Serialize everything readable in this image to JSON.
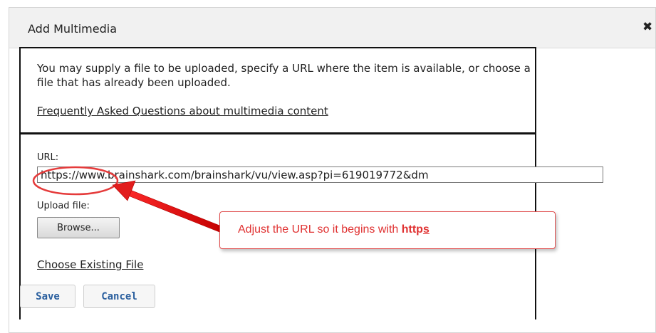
{
  "dialog": {
    "title": "Add Multimedia",
    "close_icon": "close-icon"
  },
  "intro": {
    "text": "You may supply a file to be uploaded, specify a URL where the item is available, or choose a file that has already been uploaded.",
    "faq_link": "Frequently Asked Questions about multimedia content"
  },
  "form": {
    "url_label": "URL:",
    "url_value": "https://www.brainshark.com/brainshark/vu/view.asp?pi=619019772&dm",
    "upload_label": "Upload file:",
    "browse_label": "Browse...",
    "choose_existing": "Choose Existing File"
  },
  "actions": {
    "save_label": "Save",
    "cancel_label": "Cancel"
  },
  "annotation": {
    "text": "Adjust the URL so it begins with ",
    "emphasis_prefix": "http",
    "emphasis_underlined": "s",
    "color": "#e03232"
  }
}
